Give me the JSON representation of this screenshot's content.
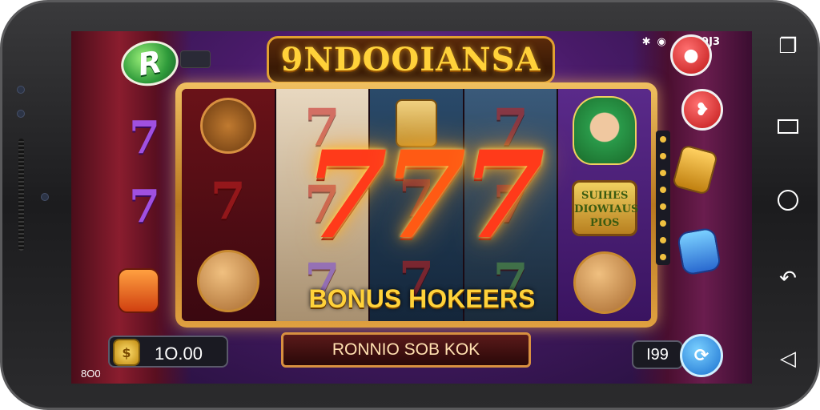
{
  "status_bar": {
    "bluetooth_icon": "bluetooth-icon",
    "wifi_icon": "wifi-icon",
    "signal_icon": "signal-icon",
    "label": "SI9J3"
  },
  "game": {
    "title": "9NDOOIANSA",
    "logo_letter": "R",
    "bonus_label": "BONUS HOKEERS",
    "big_sevens": [
      "7",
      "7",
      "7"
    ],
    "wild_badge": "SUIHES\nDIOWIAUS\nPIOS",
    "action_button": "RONNIO SOB KOK",
    "credit": "1O.00",
    "credit_small": "8O0",
    "bet": "I99"
  },
  "colors": {
    "accent_gold": "#ffd23a",
    "seven_red": "#ff3a1a",
    "background_purple": "#4a1b6a"
  },
  "nav": {
    "items": [
      "recents-icon",
      "window-icon",
      "home-icon",
      "back-icon",
      "triangle-back-icon"
    ]
  }
}
